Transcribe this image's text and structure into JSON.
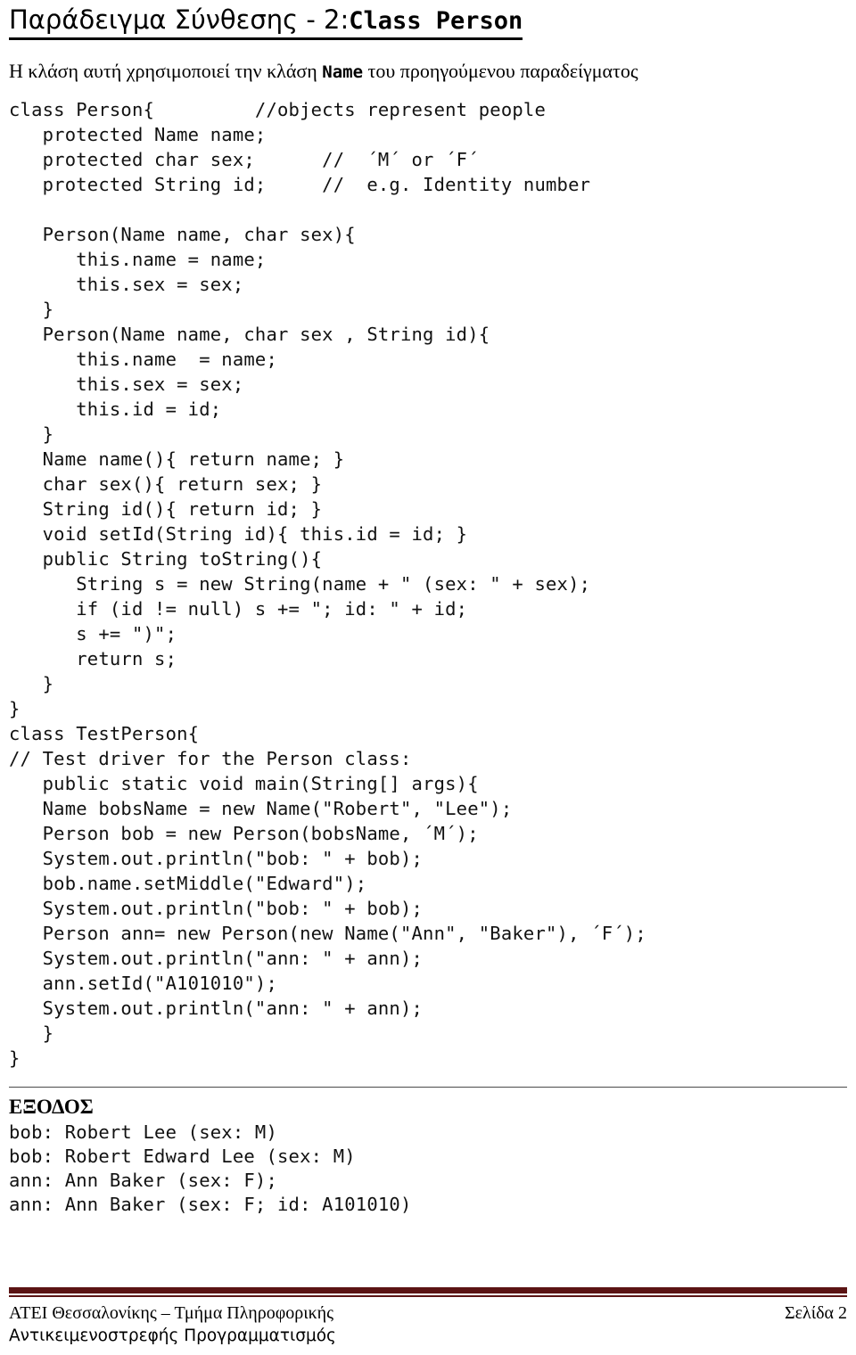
{
  "title": {
    "greek_part": "Παράδειγμα Σύνθεσης - 2:",
    "code_part": "Class Person",
    "full": "Παράδειγμα Σύνθεσης - 2: Class Person"
  },
  "subtitle": {
    "before": "Η κλάση αυτή χρησιμοποιεί την κλάση ",
    "mono": "Name",
    "after": " του προηγούμενου παραδείγματος",
    "full": "Η κλάση αυτή χρησιμοποιεί την κλάση Name του προηγούμενου παραδείγματος"
  },
  "code": {
    "language": "java",
    "lines": [
      "class Person{         //objects represent people",
      "   protected Name name;",
      "   protected char sex;      //  ´M´ or ´F´",
      "   protected String id;     //  e.g. Identity number",
      "",
      "   Person(Name name, char sex){",
      "      this.name = name;",
      "      this.sex = sex;",
      "   }",
      "   Person(Name name, char sex , String id){",
      "      this.name  = name;",
      "      this.sex = sex;",
      "      this.id = id;",
      "   }",
      "   Name name(){ return name; }",
      "   char sex(){ return sex; }",
      "   String id(){ return id; }",
      "   void setId(String id){ this.id = id; }",
      "   public String toString(){",
      "      String s = new String(name + \" (sex: \" + sex);",
      "      if (id != null) s += \"; id: \" + id;",
      "      s += \")\";",
      "      return s;",
      "   }",
      "}",
      "class TestPerson{",
      "// Test driver for the Person class:",
      "   public static void main(String[] args){",
      "   Name bobsName = new Name(\"Robert\", \"Lee\");",
      "   Person bob = new Person(bobsName, ´M´);",
      "   System.out.println(\"bob: \" + bob);",
      "   bob.name.setMiddle(\"Edward\");",
      "   System.out.println(\"bob: \" + bob);",
      "   Person ann= new Person(new Name(\"Ann\", \"Baker\"), ´F´);",
      "   System.out.println(\"ann: \" + ann);",
      "   ann.setId(\"A101010\");",
      "   System.out.println(\"ann: \" + ann);",
      "   }",
      "}"
    ]
  },
  "output": {
    "heading": "ΕΞΟΔΟΣ",
    "lines": [
      "bob: Robert Lee (sex: M)",
      "bob: Robert Edward Lee (sex: M)",
      "ann: Ann Baker (sex: F);",
      "ann: Ann Baker (sex: F; id: A101010)"
    ]
  },
  "footer": {
    "line1": "ΑΤΕΙ Θεσσαλονίκης – Τμήμα Πληροφορικής",
    "line2": "Αντικειμενοστρεφής Προγραμματισμός",
    "page": "Σελίδα 2",
    "rule_color": "#5b1414"
  }
}
